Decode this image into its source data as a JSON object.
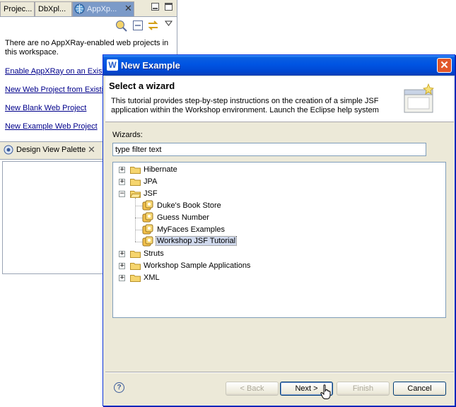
{
  "background": {
    "tabs": [
      "Projec...",
      "DbXpl...",
      "AppXp..."
    ],
    "message": "There are no AppXRay-enabled web projects in this workspace.",
    "links": [
      "Enable AppXRay on an Existi",
      "New Web Project from Existi",
      "New Blank Web Project",
      "New Example Web Project"
    ],
    "palette_tab": "Design View Palette"
  },
  "dialog": {
    "title": "New Example",
    "header_title": "Select a wizard",
    "header_desc": "This tutorial provides step-by-step instructions on the creation of a simple JSF application within the Workshop environment. Launch the Eclipse help system",
    "wizards_label": "Wizards:",
    "filter_value": "type filter text",
    "tree": [
      {
        "label": "Hibernate",
        "expanded": false
      },
      {
        "label": "JPA",
        "expanded": false
      },
      {
        "label": "JSF",
        "expanded": true,
        "children": [
          "Duke's Book Store",
          "Guess Number",
          "MyFaces Examples",
          "Workshop JSF Tutorial"
        ]
      },
      {
        "label": "Struts",
        "expanded": false
      },
      {
        "label": "Workshop Sample Applications",
        "expanded": false
      },
      {
        "label": "XML",
        "expanded": false
      }
    ],
    "selected": "Workshop JSF Tutorial",
    "buttons": {
      "back": "< Back",
      "next": "Next >",
      "finish": "Finish",
      "cancel": "Cancel"
    }
  },
  "colors": {
    "titlebar": "#0054e3",
    "selection": "#cfd8ec",
    "link": "#00008b"
  },
  "icons": [
    "appxray-icon",
    "minimize-icon",
    "sync-icon",
    "view-menu-icon",
    "palette-icon",
    "wizard-icon",
    "close-icon",
    "folder-icon",
    "example-icon",
    "help-icon"
  ]
}
